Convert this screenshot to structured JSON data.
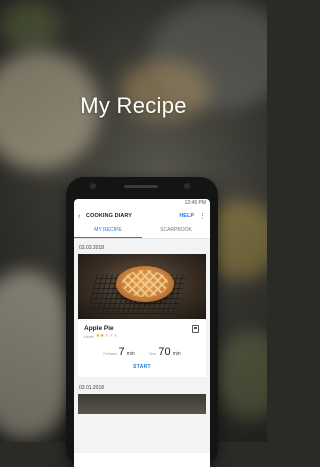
{
  "headline": "My Recipe",
  "status": {
    "time": "12:45 PM"
  },
  "app": {
    "title": "COOKING DIARY",
    "help_label": "HELP"
  },
  "tabs": [
    {
      "label": "MY RECIPE",
      "active": true
    },
    {
      "label": "SCARPBOOK",
      "active": false
    }
  ],
  "entries": [
    {
      "date": "03.03.2018",
      "name": "Apple Pie",
      "level_label": "Level",
      "stars_filled": 2,
      "stars_total": 5,
      "prep_label": "Prehead",
      "prep_value": "7",
      "prep_unit": "min",
      "time_label": "Time",
      "time_value": "70",
      "time_unit": "min",
      "start_label": "START"
    },
    {
      "date": "03.01.2018"
    }
  ],
  "colors": {
    "accent": "#1f7be0",
    "star": "#f0a020"
  },
  "icons": [
    "back-arrow-icon",
    "more-vert-icon",
    "bookmark-icon",
    "star-icon"
  ]
}
